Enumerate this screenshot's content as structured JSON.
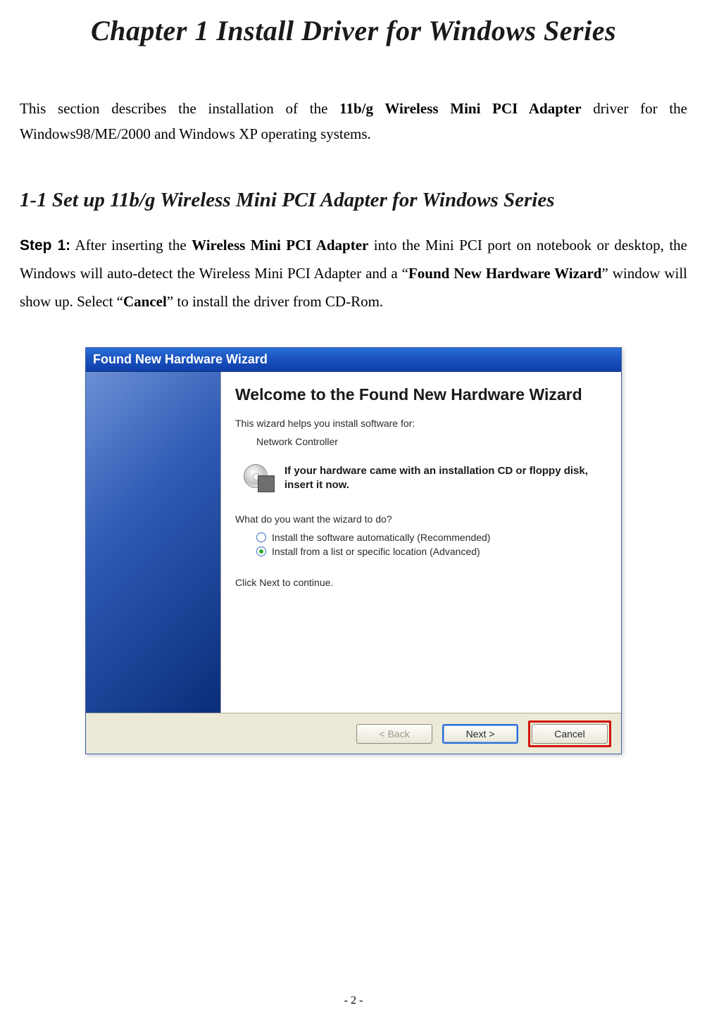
{
  "chapter_title": "Chapter 1 Install Driver for Windows Series",
  "intro": {
    "pre": "This section describes the installation of the ",
    "bold": "11b/g Wireless Mini PCI Adapter",
    "post": " driver for the Windows98/ME/2000 and Windows XP operating systems."
  },
  "section_title": "1-1 Set up 11b/g Wireless Mini PCI Adapter for Windows Series",
  "step1": {
    "label": "Step 1:",
    "t1": " After inserting the ",
    "b1": "Wireless Mini PCI Adapter",
    "t2": " into the Mini PCI port on notebook or desktop, the Windows will auto-detect the Wireless Mini PCI Adapter and a “",
    "b2": "Found New Hardware Wizard",
    "t3": "” window will show up. Select “",
    "b3": "Cancel",
    "t4": "” to install the driver from CD-Rom."
  },
  "wizard": {
    "titlebar": "Found New Hardware Wizard",
    "heading": "Welcome to the Found New Hardware Wizard",
    "helps": "This wizard helps you install software for:",
    "device": "Network Controller",
    "cd_text": "If your hardware came with an installation CD or floppy disk, insert it now.",
    "prompt": "What do you want the wizard to do?",
    "radio1": "Install the software automatically (Recommended)",
    "radio2": "Install from a list or specific location (Advanced)",
    "continue": "Click Next to continue.",
    "buttons": {
      "back": "< Back",
      "next": "Next >",
      "cancel": "Cancel"
    }
  },
  "page_number": "- 2 -"
}
